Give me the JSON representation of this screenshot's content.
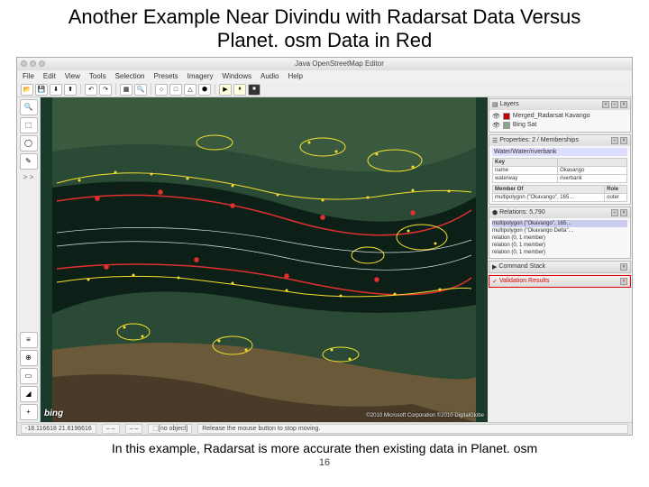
{
  "slide": {
    "title": "Another Example Near Divindu with Radarsat Data Versus Planet. osm Data in Red",
    "caption": "In this example, Radarsat is more accurate then existing data in Planet. osm",
    "page_number": "16"
  },
  "window": {
    "title": "Java OpenStreetMap Editor"
  },
  "menubar": {
    "items": [
      "File",
      "Edit",
      "View",
      "Tools",
      "Selection",
      "Presets",
      "Imagery",
      "Windows",
      "Audio",
      "Help"
    ]
  },
  "toolbar": {
    "open": "📂",
    "save": "💾",
    "download": "⬇",
    "upload": "⬆",
    "undo": "↶",
    "redo": "↷",
    "grid": "▦",
    "search": "🔍",
    "play": "▶",
    "pause": "⏸",
    "stop": "⏹"
  },
  "left_tools": {
    "zoom": "🔍",
    "select": "⬚",
    "lasso": "◯",
    "draw": "✎",
    "expand": "> >",
    "parallel": "≡",
    "improve": "⊕",
    "building": "▭",
    "angle": "◢",
    "add": "+"
  },
  "panels": {
    "layers": {
      "title": "Layers",
      "items": [
        {
          "name": "Merged_Radarsat Kavango",
          "color": "#c00"
        },
        {
          "name": "Bing Sat",
          "color": "#8a8"
        }
      ]
    },
    "properties": {
      "title": "Properties: 2 / Memberships",
      "selection": "Water/Water/riverbank",
      "key_header": "Key",
      "rows": [
        {
          "k": "name",
          "v": "Okavango"
        },
        {
          "k": "waterway",
          "v": "riverbank"
        }
      ],
      "member_of": "Member Of",
      "member_role": "Role",
      "member_row": {
        "rel": "multipolygon (\"Okavango\", 165…",
        "role": "outer"
      }
    },
    "relations": {
      "title": "Relations: 5,790",
      "items": [
        "multipolygon (\"Okavango\", 165…",
        "multipolygon (\"Okavango Delta\"…",
        "relation (0, 1 member)",
        "relation (0, 1 member)",
        "relation (0, 1 member)"
      ]
    },
    "command_stack": {
      "title": "Command Stack"
    },
    "validation": {
      "title": "Validation Results"
    }
  },
  "statusbar": {
    "coords": "-18.116618   21.6196616",
    "heading": "– –",
    "angle": "– –",
    "object": "[no object]",
    "hint": "Release the mouse button to stop moving."
  },
  "map": {
    "logo": "bing",
    "attribution": "©2010 Microsoft Corporation ©2010 DigitalGlobe"
  }
}
